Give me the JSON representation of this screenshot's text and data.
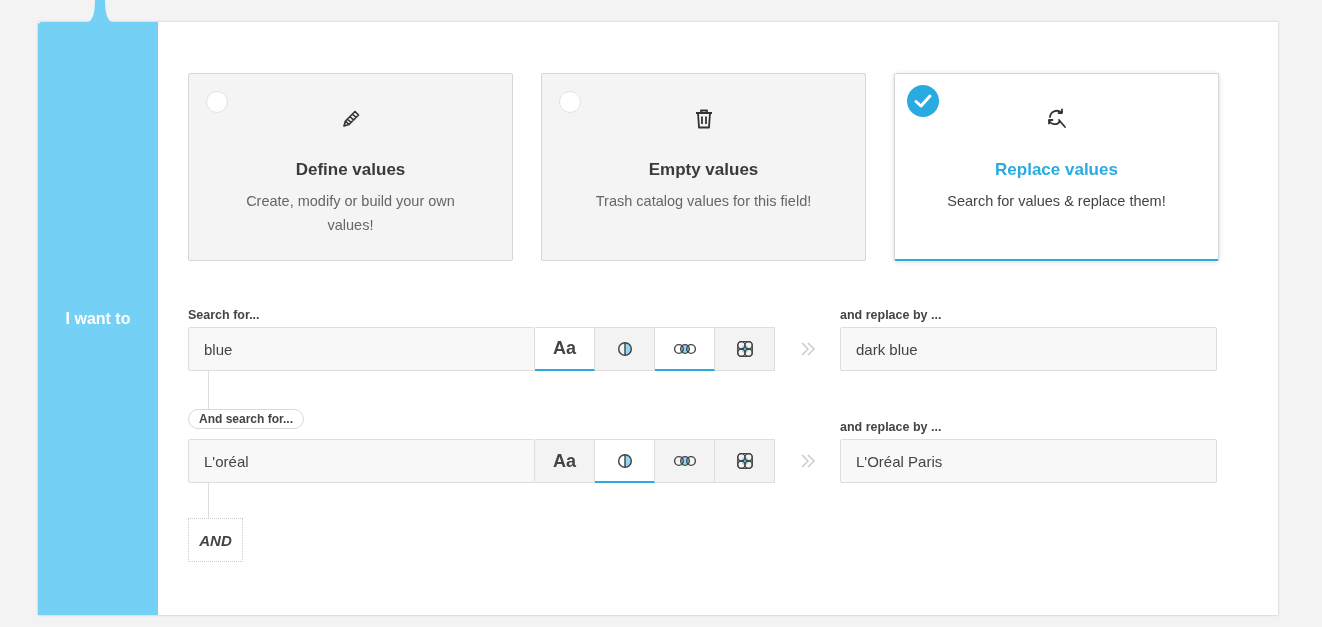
{
  "sidebar": {
    "label": "I want to"
  },
  "options": [
    {
      "kind": "pencil",
      "title": "Define values",
      "description": "Create, modify or build your own values!",
      "selected": false
    },
    {
      "kind": "trash",
      "title": "Empty values",
      "description": "Trash catalog values for this field!",
      "selected": false
    },
    {
      "kind": "replace",
      "title": "Replace values",
      "description": "Search for values & replace them!",
      "selected": true
    }
  ],
  "rows": [
    {
      "kind": "plain",
      "label": "Search for...",
      "value": "blue",
      "toggles": [
        {
          "kind": "case",
          "label": "Aa",
          "on": true
        },
        {
          "kind": "half-circle",
          "on": false
        },
        {
          "kind": "three-circles",
          "on": true
        },
        {
          "kind": "grid",
          "on": false
        }
      ],
      "replace_label": "and replace by ...",
      "replace_value": "dark blue"
    },
    {
      "kind": "pill",
      "label": "And search for...",
      "value": "L'oréal",
      "toggles": [
        {
          "kind": "case",
          "label": "Aa",
          "on": false
        },
        {
          "kind": "half-circle",
          "on": true
        },
        {
          "kind": "three-circles",
          "on": false
        },
        {
          "kind": "grid",
          "on": false
        }
      ],
      "replace_label": "and replace by ...",
      "replace_value": "L'Oréal Paris"
    }
  ],
  "add_button": "AND"
}
